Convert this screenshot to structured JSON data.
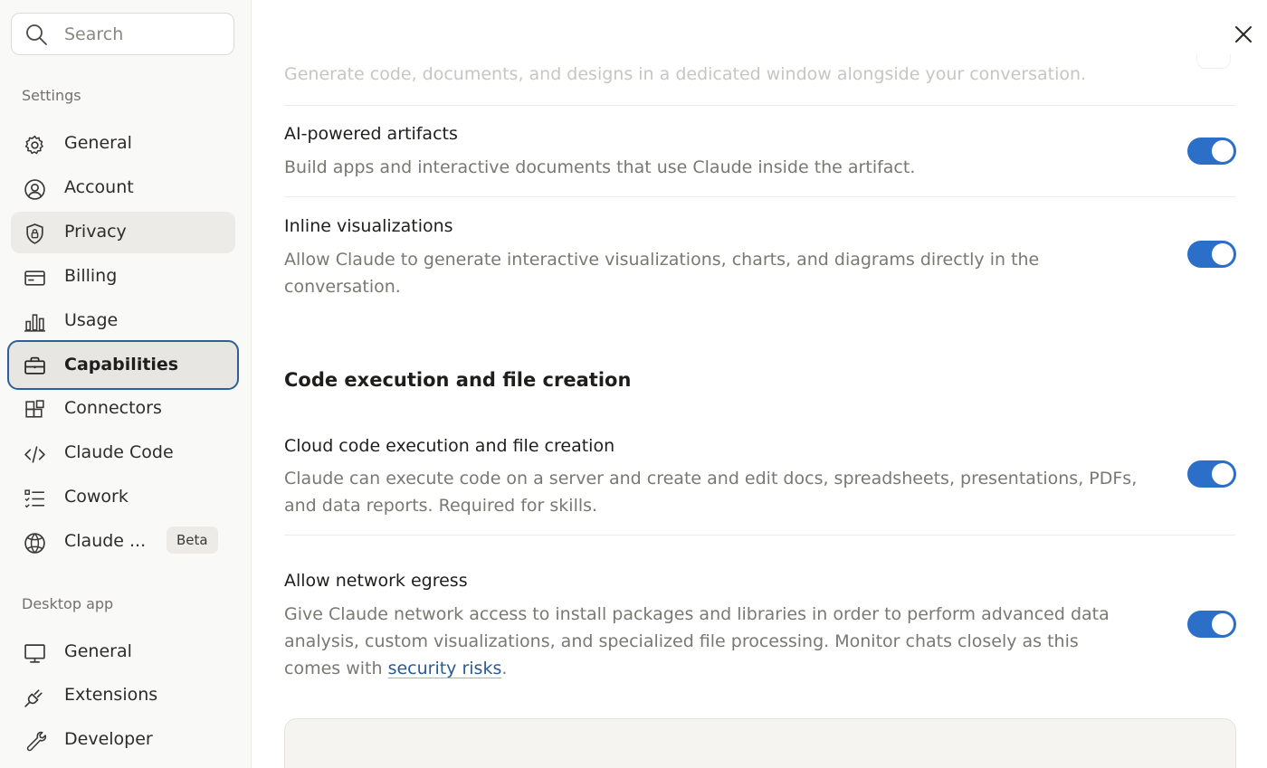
{
  "search": {
    "placeholder": "Search"
  },
  "sidebar": {
    "settings_label": "Settings",
    "settings_items": [
      {
        "label": "General",
        "icon": "gear-icon"
      },
      {
        "label": "Account",
        "icon": "user-circle-icon"
      },
      {
        "label": "Privacy",
        "icon": "shield-lock-icon"
      },
      {
        "label": "Billing",
        "icon": "credit-card-icon"
      },
      {
        "label": "Usage",
        "icon": "bar-chart-icon"
      },
      {
        "label": "Capabilities",
        "icon": "briefcase-icon"
      },
      {
        "label": "Connectors",
        "icon": "blocks-icon"
      },
      {
        "label": "Claude Code",
        "icon": "code-icon"
      },
      {
        "label": "Cowork",
        "icon": "checklist-icon"
      },
      {
        "label": "Claude ...",
        "icon": "globe-icon",
        "badge": "Beta"
      }
    ],
    "desktop_label": "Desktop app",
    "desktop_items": [
      {
        "label": "General",
        "icon": "monitor-icon"
      },
      {
        "label": "Extensions",
        "icon": "plug-icon"
      },
      {
        "label": "Developer",
        "icon": "wrench-icon"
      }
    ]
  },
  "main": {
    "faded_desc": "Generate code, documents, and designs in a dedicated window alongside your conversation.",
    "settings": [
      {
        "title": "AI-powered artifacts",
        "desc": "Build apps and interactive documents that use Claude inside the artifact.",
        "enabled": true
      },
      {
        "title": "Inline visualizations",
        "desc": "Allow Claude to generate interactive visualizations, charts, and diagrams directly in the conversation.",
        "enabled": true
      }
    ],
    "section_title": "Code execution and file creation",
    "code_settings": [
      {
        "title": "Cloud code execution and file creation",
        "desc": "Claude can execute code on a server and create and edit docs, spreadsheets, presentations, PDFs, and data reports. Required for skills.",
        "enabled": true
      },
      {
        "title": "Allow network egress",
        "desc_prefix": "Give Claude network access to install packages and libraries in order to perform advanced data analysis, custom visualizations, and specialized file processing. Monitor chats closely as this comes with ",
        "link_text": "security risks",
        "desc_suffix": ".",
        "enabled": true
      }
    ]
  },
  "colors": {
    "accent": "#2b6fc9",
    "selected_border": "#2f5f98",
    "link": "#2a5a92"
  }
}
